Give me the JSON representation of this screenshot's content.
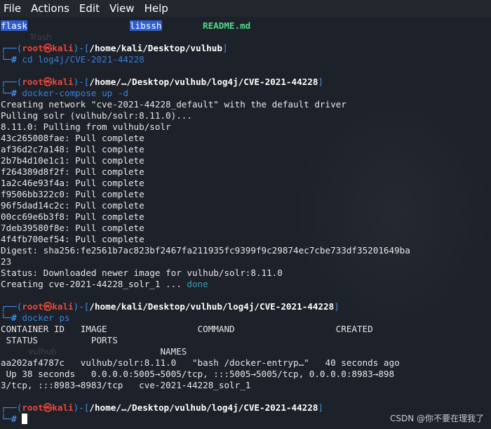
{
  "menubar": {
    "items": [
      "File",
      "Actions",
      "Edit",
      "View",
      "Help"
    ]
  },
  "terminal": {
    "ls_items": {
      "flask": "flask",
      "libssh": "libssh",
      "readme": "README.md"
    },
    "ghost_labels": {
      "trash": "Trash",
      "vulhub": "vulhub"
    },
    "prompt_user": "root",
    "prompt_at": "㉿",
    "prompt_host": "kali",
    "prompt_top_left": "┌──(",
    "prompt_mid": ")-[",
    "prompt_close": "]",
    "prompt_bottom": "└─",
    "prompt_hash": "#",
    "block1": {
      "path": "/home/kali/Desktop/vulhub",
      "command": "cd log4j/CVE-2021-44228"
    },
    "block2": {
      "path": "/home/…/Desktop/vulhub/log4j/CVE-2021-44228",
      "command_name": "docker-compose",
      "command_args": " up -d",
      "output": [
        "Creating network \"cve-2021-44228_default\" with the default driver",
        "Pulling solr (vulhub/solr:8.11.0)...",
        "8.11.0: Pulling from vulhub/solr",
        "43c265008fae: Pull complete",
        "af36d2c7a148: Pull complete",
        "2b7b4d10e1c1: Pull complete",
        "f264389d8f2f: Pull complete",
        "1a2c46e93f4a: Pull complete",
        "f9506bb322c0: Pull complete",
        "96f5dad14c2c: Pull complete",
        "00cc69e6b3f8: Pull complete",
        "7deb39580f8e: Pull complete",
        "4f4fb700ef54: Pull complete",
        "Digest: sha256:fe2561b7ac823bf2467fa211935fc9399f9c29874ec7cbe733df35201649ba",
        "23",
        "Status: Downloaded newer image for vulhub/solr:8.11.0"
      ],
      "creating_text": "Creating cve-2021-44228_solr_1 ... ",
      "done_text": "done"
    },
    "block3": {
      "path": "/home/kali/Desktop/vulhub/log4j/CVE-2021-44228",
      "command": "docker ps",
      "output": [
        "CONTAINER ID   IMAGE                 COMMAND                   CREATED",
        " STATUS          PORTS",
        "                              NAMES",
        "aa202af4787c   vulhub/solr:8.11.0   \"bash /docker-entryp…\"   40 seconds ago",
        " Up 38 seconds   0.0.0.0:5005→5005/tcp, :::5005→5005/tcp, 0.0.0.0:8983→898",
        "3/tcp, :::8983→8983/tcp   cve-2021-44228_solr_1"
      ]
    },
    "block4": {
      "path": "/home/…/Desktop/vulhub/log4j/CVE-2021-44228"
    }
  },
  "watermark": "CSDN @你不要在理我了"
}
